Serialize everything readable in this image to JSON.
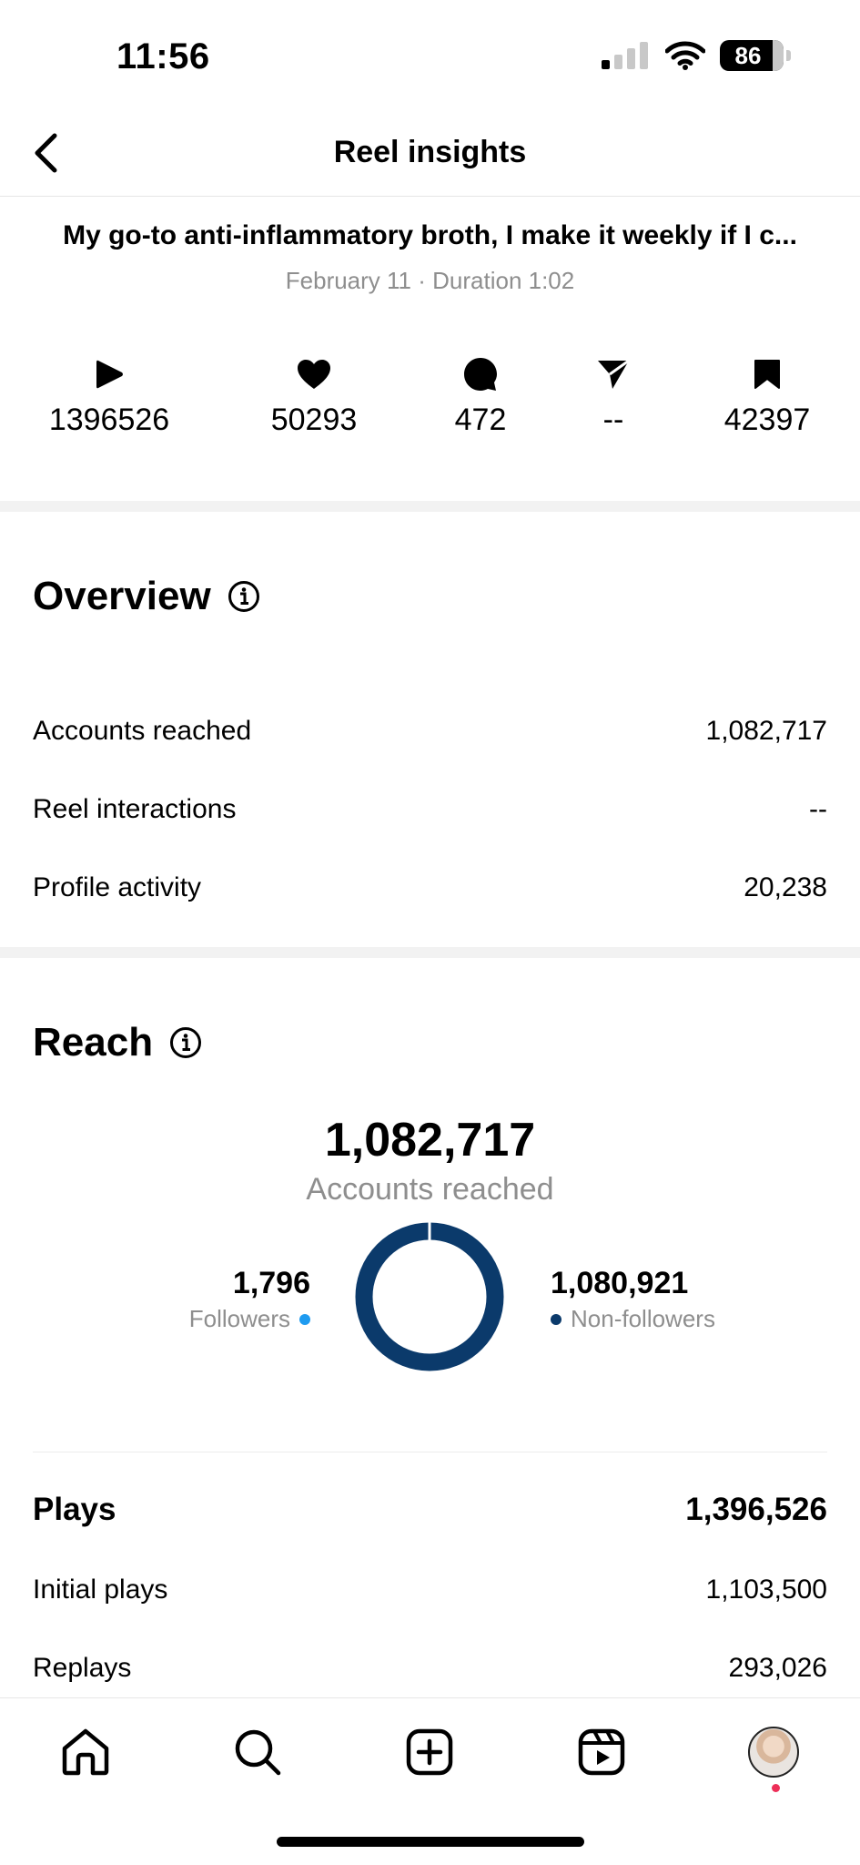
{
  "status_bar": {
    "time": "11:56",
    "battery": "86"
  },
  "header": {
    "title": "Reel insights"
  },
  "reel": {
    "title": "My go-to anti-inflammatory broth, I make it weekly if I c...",
    "meta": "February 11 · Duration 1:02"
  },
  "stats": [
    {
      "icon": "play-icon",
      "value": "1396526"
    },
    {
      "icon": "heart-icon",
      "value": "50293"
    },
    {
      "icon": "comment-icon",
      "value": "472"
    },
    {
      "icon": "share-icon",
      "value": "--"
    },
    {
      "icon": "bookmark-icon",
      "value": "42397"
    }
  ],
  "overview": {
    "title": "Overview",
    "rows": [
      {
        "label": "Accounts reached",
        "value": "1,082,717"
      },
      {
        "label": "Reel interactions",
        "value": "--"
      },
      {
        "label": "Profile activity",
        "value": "20,238"
      }
    ]
  },
  "reach": {
    "title": "Reach",
    "total": "1,082,717",
    "total_label": "Accounts reached",
    "followers": {
      "value": "1,796",
      "label": "Followers",
      "count": 1796,
      "color": "#1e9bf0"
    },
    "non_followers": {
      "value": "1,080,921",
      "label": "Non-followers",
      "count": 1080921,
      "color": "#0b3a6b"
    }
  },
  "plays": {
    "title": "Plays",
    "total": "1,396,526",
    "rows": [
      {
        "label": "Initial plays",
        "value": "1,103,500"
      },
      {
        "label": "Replays",
        "value": "293,026"
      }
    ]
  },
  "tab_bar": {
    "tabs": [
      "home-icon",
      "search-icon",
      "create-icon",
      "reels-icon",
      "profile-avatar"
    ],
    "notification_color": "#ed2f58"
  },
  "colors": {
    "divider": "#f2f2f2",
    "secondary_text": "#8e8e8e"
  }
}
